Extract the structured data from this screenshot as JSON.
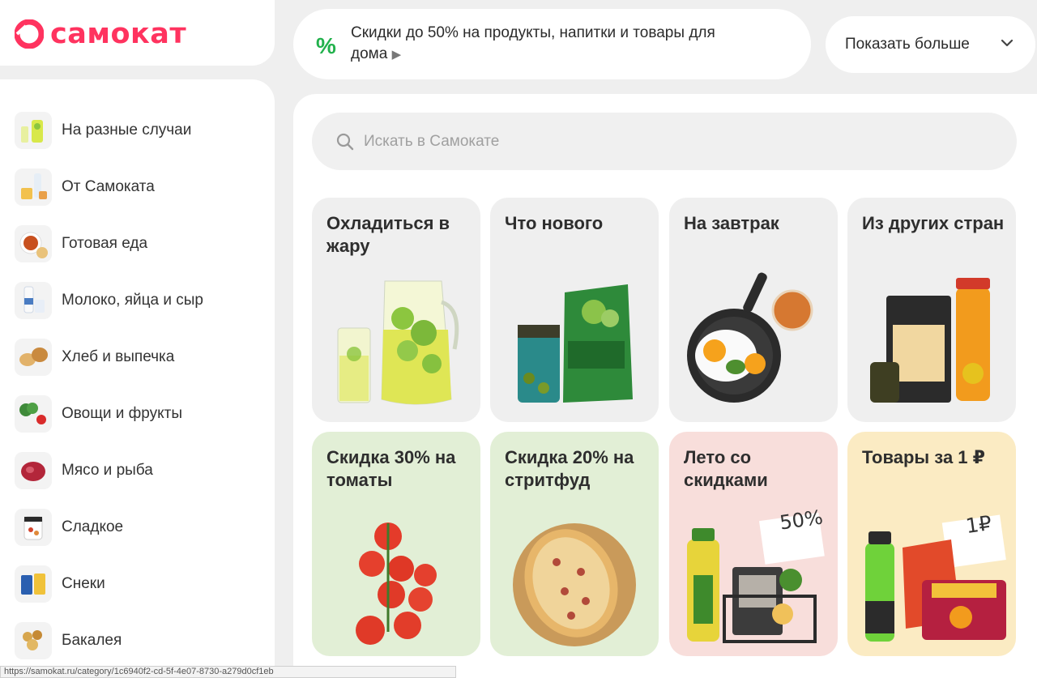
{
  "brand": {
    "name": "самокат",
    "color": "#ff335f"
  },
  "promo": {
    "icon": "percent-icon",
    "text": "Скидки до 50% на продукты, напитки и товары для дома",
    "arrow": "▶",
    "close": "×"
  },
  "more_button": {
    "label": "Показать больше",
    "icon": "chevron-down-icon"
  },
  "search": {
    "placeholder": "Искать в Самокате",
    "value": ""
  },
  "sidebar": {
    "items": [
      {
        "label": "На разные случаи",
        "icon": "drinks-icon"
      },
      {
        "label": "От Самоката",
        "icon": "milk-bottle-icon"
      },
      {
        "label": "Готовая еда",
        "icon": "soup-icon"
      },
      {
        "label": "Молоко, яйца и сыр",
        "icon": "milk-icon"
      },
      {
        "label": "Хлеб и выпечка",
        "icon": "bread-icon"
      },
      {
        "label": "Овощи и фрукты",
        "icon": "broccoli-icon"
      },
      {
        "label": "Мясо и рыба",
        "icon": "meat-icon"
      },
      {
        "label": "Сладкое",
        "icon": "sweets-icon"
      },
      {
        "label": "Снеки",
        "icon": "snacks-icon"
      },
      {
        "label": "Бакалея",
        "icon": "grocery-icon"
      }
    ]
  },
  "tiles": [
    {
      "title": "Охладиться в жару",
      "bg": "#efefef"
    },
    {
      "title": "Что нового",
      "bg": "#efefef"
    },
    {
      "title": "На завтрак",
      "bg": "#efefef"
    },
    {
      "title": "Из других стран",
      "bg": "#efefef"
    },
    {
      "title": "Скидка 30% на томаты",
      "bg": "#e2efd6"
    },
    {
      "title": "Скидка 20% на стритфуд",
      "bg": "#e2efd6"
    },
    {
      "title": "Лето со скидками",
      "bg": "#f8dedb",
      "badge": "50%"
    },
    {
      "title": "Товары за 1 ₽",
      "bg": "#fbebc3",
      "badge": "1₽"
    }
  ],
  "status_bar": {
    "url": "https://samokat.ru/category/1c6940f2-cd-5f-4e07-8730-a279d0cf1eb"
  }
}
